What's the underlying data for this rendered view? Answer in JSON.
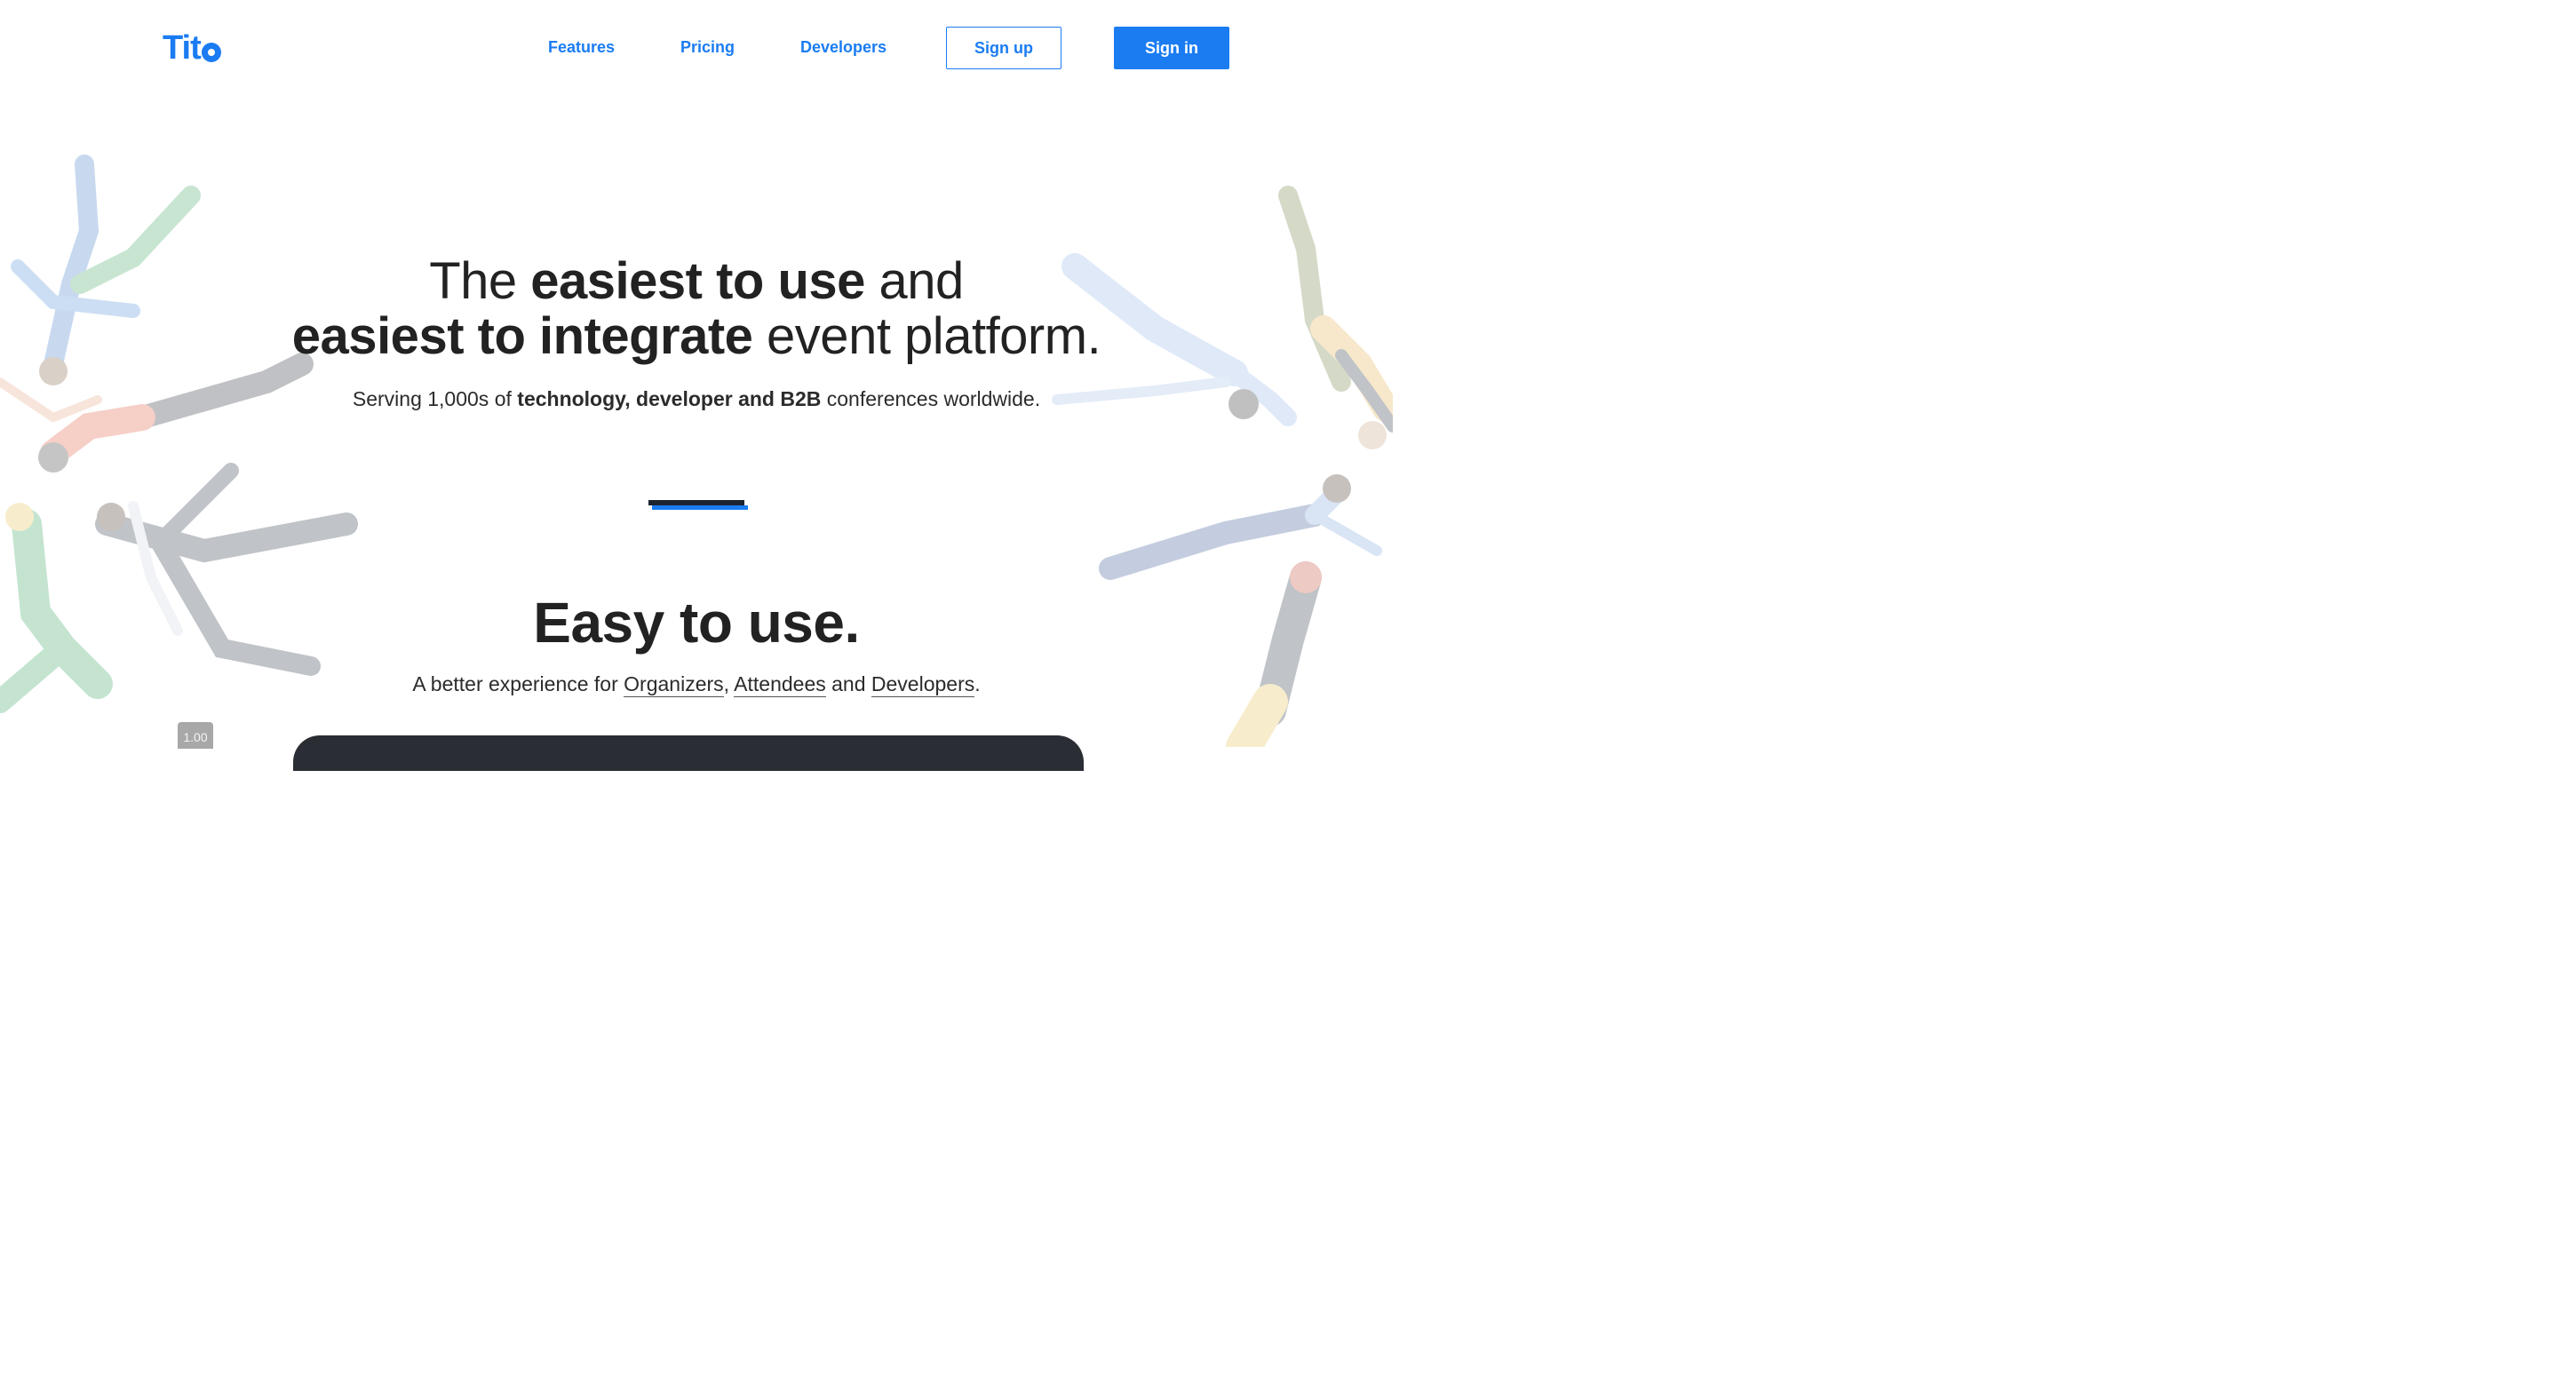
{
  "nav": {
    "logo": "Tit",
    "links": [
      "Features",
      "Pricing",
      "Developers"
    ],
    "signup_label": "Sign up",
    "signin_label": "Sign in",
    "brand_color": "#1b7cf2"
  },
  "hero": {
    "line1_pre": "The ",
    "line1_bold": "easiest to use",
    "line1_post": " and",
    "line2_bold": "easiest to integrate",
    "line2_post": " event platform.",
    "sub_pre": "Serving 1,000s of ",
    "sub_bold": "technology, developer and B2B",
    "sub_post": " conferences worldwide."
  },
  "section": {
    "title": "Easy to use.",
    "sub_pre": "A better experience for ",
    "organizers": "Organizers",
    "comma": ",",
    "attendees": "Attendees",
    "and": " and ",
    "developers": "Developers",
    "period": "."
  },
  "zoom_indicator": "1.00"
}
